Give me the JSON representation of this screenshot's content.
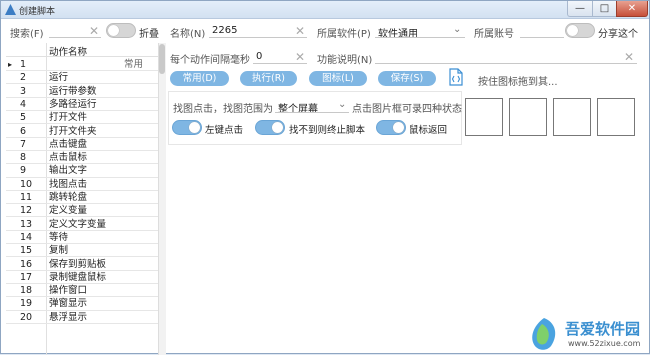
{
  "window": {
    "title": "创建脚本",
    "min": "—",
    "max": "□",
    "close": "✕"
  },
  "left": {
    "search_label": "搜索(F)",
    "fold_label": "折叠",
    "col_header": "动作名称",
    "common_label": "常用",
    "current_marker": "▸",
    "rows": [
      {
        "num": "1",
        "name": ""
      },
      {
        "num": "2",
        "name": "运行"
      },
      {
        "num": "3",
        "name": "运行带参数"
      },
      {
        "num": "4",
        "name": "多路径运行"
      },
      {
        "num": "5",
        "name": "打开文件"
      },
      {
        "num": "6",
        "name": "打开文件夹"
      },
      {
        "num": "7",
        "name": "点击键盘"
      },
      {
        "num": "8",
        "name": "点击鼠标"
      },
      {
        "num": "9",
        "name": "输出文字"
      },
      {
        "num": "10",
        "name": "找图点击"
      },
      {
        "num": "11",
        "name": "跳转轮盘"
      },
      {
        "num": "12",
        "name": "定义变量"
      },
      {
        "num": "13",
        "name": "定义文字变量"
      },
      {
        "num": "14",
        "name": "等待"
      },
      {
        "num": "15",
        "name": "复制"
      },
      {
        "num": "16",
        "name": "保存到剪贴板"
      },
      {
        "num": "17",
        "name": "录制键盘鼠标"
      },
      {
        "num": "18",
        "name": "操作窗口"
      },
      {
        "num": "19",
        "name": "弹窗显示"
      },
      {
        "num": "20",
        "name": "悬浮显示"
      }
    ]
  },
  "form": {
    "name_label": "名称(N)",
    "name_value": "2265",
    "software_label": "所属软件(P)",
    "software_value": "软件通用",
    "account_label": "所属账号",
    "share_label": "分享这个",
    "interval_label": "每个动作间隔毫秒",
    "interval_value": "0",
    "desc_label": "功能说明(N)",
    "buttons": [
      "常用(D)",
      "执行(R)",
      "图标(L)",
      "保存(S)"
    ],
    "drag_hint": "按住图标拖到其..."
  },
  "findimg": {
    "range_label": "找图点击，找图范围为",
    "range_value": "整个屏幕",
    "hint": "点击图片框可录四种状态",
    "toggles": [
      "左键点击",
      "找不到则终止脚本",
      "鼠标返回"
    ]
  },
  "watermark": {
    "text": "吾爱软件园",
    "url": "www.52zixue.com"
  },
  "colors": {
    "accent": "#7fb6e3",
    "watermark": "#3a8fd0"
  }
}
